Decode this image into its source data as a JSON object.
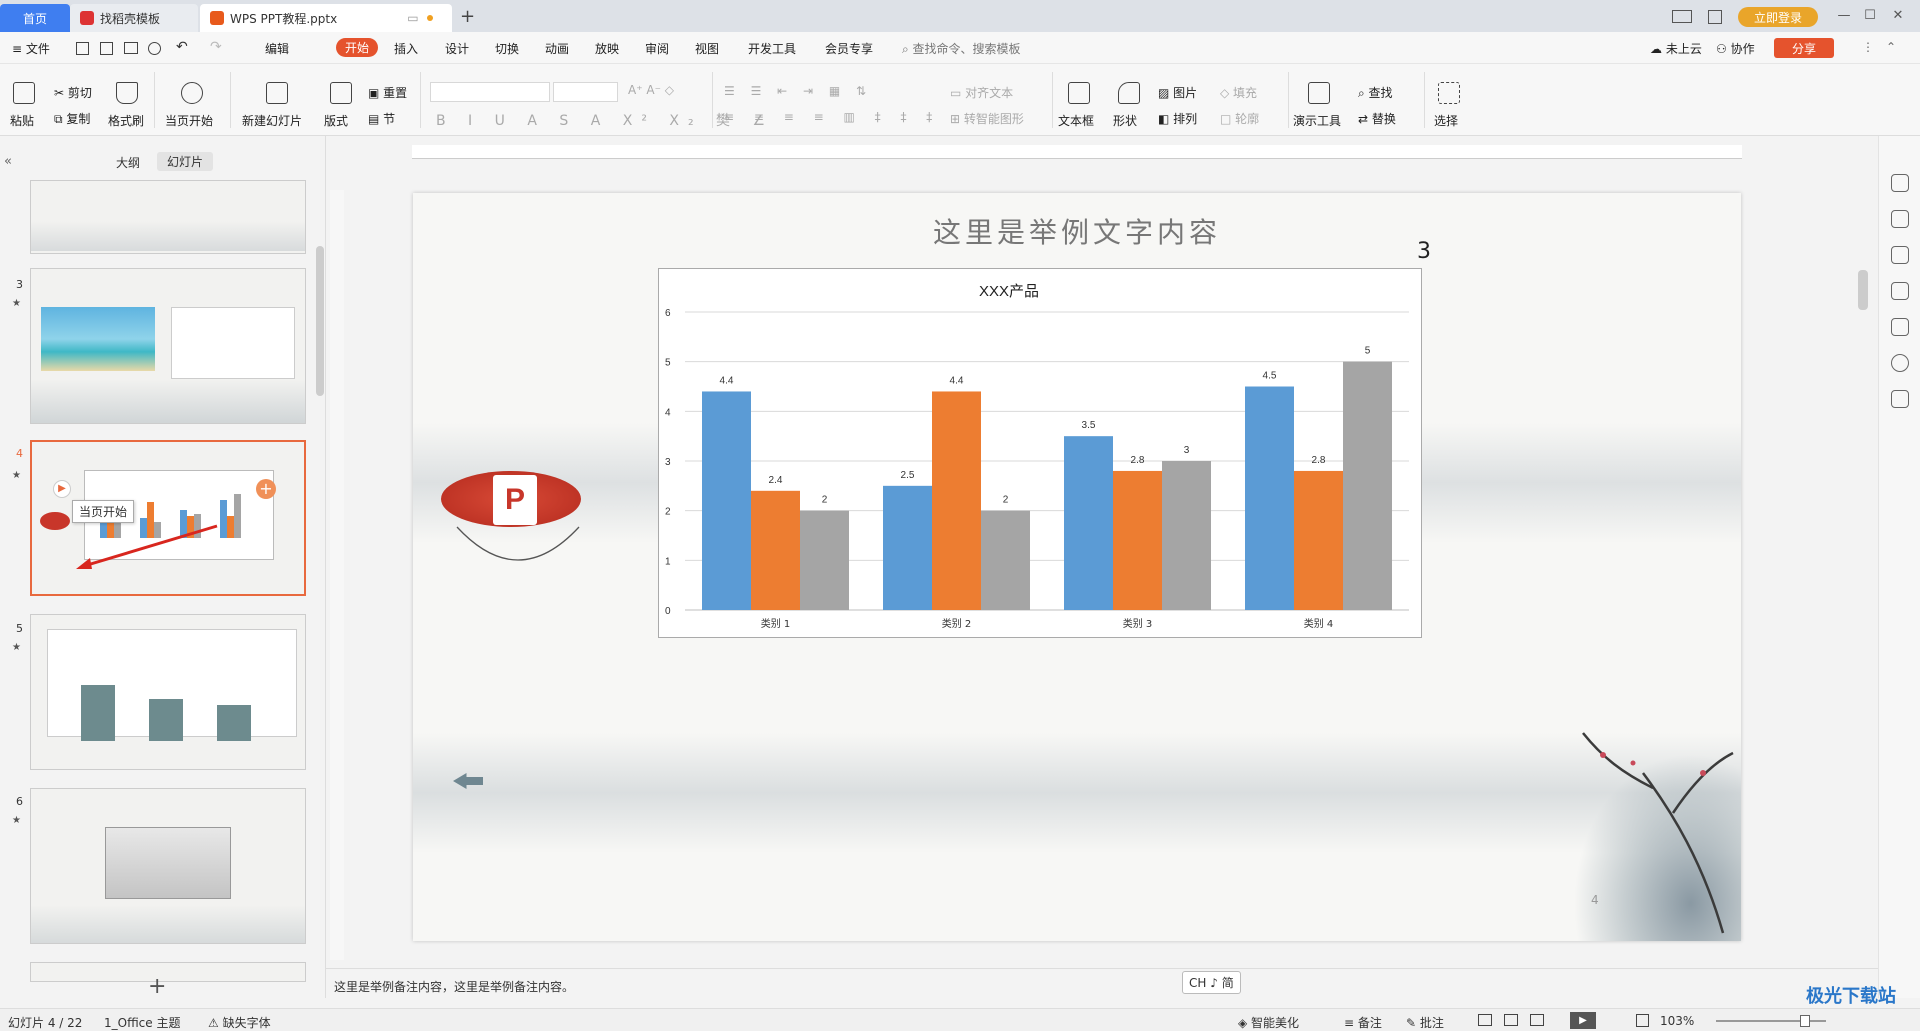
{
  "tabs": {
    "home": "首页",
    "template": "找稻壳模板",
    "doc": "WPS PPT教程.pptx",
    "login": "立即登录"
  },
  "menu": [
    "文件",
    "编辑",
    "开始",
    "插入",
    "设计",
    "切换",
    "动画",
    "放映",
    "审阅",
    "视图",
    "开发工具",
    "会员专享"
  ],
  "menu_search": "查找命令、搜索模板",
  "menu_right": {
    "cloud": "未上云",
    "collab": "协作",
    "share": "分享"
  },
  "toolbar": {
    "paste": "粘贴",
    "cut": "剪切",
    "copy": "复制",
    "format_painter": "格式刷",
    "play_current": "当页开始",
    "new_slide": "新建幻灯片",
    "layout": "版式",
    "reset": "重置",
    "section": "节",
    "align_text": "对齐文本",
    "smart_graphic": "转智能图形",
    "textbox": "文本框",
    "shape": "形状",
    "picture": "图片",
    "arrange": "排列",
    "fill": "填充",
    "outline": "轮廓",
    "present_tool": "演示工具",
    "find": "查找",
    "replace": "替换",
    "select": "选择"
  },
  "left": {
    "outline_tab": "大纲",
    "slides_tab": "幻灯片",
    "numbers": [
      "3",
      "4",
      "5",
      "6"
    ],
    "tooltip": "当页开始"
  },
  "slide": {
    "title": "这里是举例文字内容",
    "number_text": "3",
    "page_number": "4",
    "chart_title": "XXX产品"
  },
  "chart_data": {
    "type": "bar",
    "title": "XXX产品",
    "categories": [
      "类别 1",
      "类别 2",
      "类别 3",
      "类别 4"
    ],
    "series": [
      {
        "values": [
          4.4,
          2.5,
          3.5,
          4.5
        ],
        "color": "#5b9bd5"
      },
      {
        "values": [
          2.4,
          4.4,
          2.8,
          2.8
        ],
        "color": "#ed7d31"
      },
      {
        "values": [
          2,
          2,
          3,
          5
        ],
        "color": "#a5a5a5"
      }
    ],
    "ylim": [
      0,
      6
    ],
    "yticks": [
      "0",
      "1",
      "2",
      "3",
      "4",
      "5",
      "6"
    ],
    "grid": true
  },
  "notes": "这里是举例备注内容，这里是举例备注内容。",
  "ime": "CH ♪ 简",
  "status": {
    "slide_count": "幻灯片 4 / 22",
    "theme": "1_Office 主题",
    "missing_font": "缺失字体",
    "smart_beautify": "智能美化",
    "notes_btn": "备注",
    "comment_btn": "批注",
    "zoom": "103%"
  },
  "watermark": "极光下载站"
}
